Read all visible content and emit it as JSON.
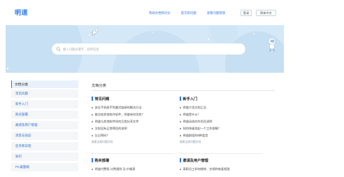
{
  "header": {
    "logo": "明道",
    "nav": [
      "帮助文档和讨论",
      "提交新问题",
      "查看问题管理"
    ],
    "login_label": "登录",
    "lang_label": "简体中文"
  },
  "search": {
    "placeholder": "输入问题关键字，找到答案"
  },
  "sidebar": {
    "title": "文档分类",
    "items": [
      "常见问题",
      "新手入门",
      "购买部署",
      "邀请及用户管理",
      "消息与动态",
      "任务和日程",
      "知识",
      "PC桌面端"
    ]
  },
  "content": {
    "title": "文档分类",
    "categories": [
      {
        "title": "常见问题",
        "items": [
          "安全手机收不到激活链接的解决方法",
          "能比较其他协作软件，明道有何优势？",
          "明道与其他软件如何互相分享文件",
          "文档没有正常预览的说明",
          "忘记密码？"
        ],
        "more": "查看全部问题文档"
      },
      {
        "title": "新手入门",
        "items": [
          "明道介绍文档汇总",
          "明道是什么？",
          "明道动态的作用及说明",
          "如何快速发起一个工作群聊？",
          "明道群组的5种类型"
        ],
        "more": "查看全部问题文档"
      },
      {
        "title": "购买部署",
        "items": [
          "明道付费版 计费规则 及 价格表"
        ]
      },
      {
        "title": "邀请及用户管理",
        "items": [
          "离职员工如何移除、交接和恢复权限"
        ]
      }
    ]
  },
  "colors": {
    "accent": "#2d7be8",
    "hero_bg": "#d4e8f7",
    "sidebar_active_bg": "#e9f2fb"
  },
  "icons": {
    "search": "search-icon",
    "rocket": "rocket-icon",
    "astronaut": "astronaut-icon"
  }
}
